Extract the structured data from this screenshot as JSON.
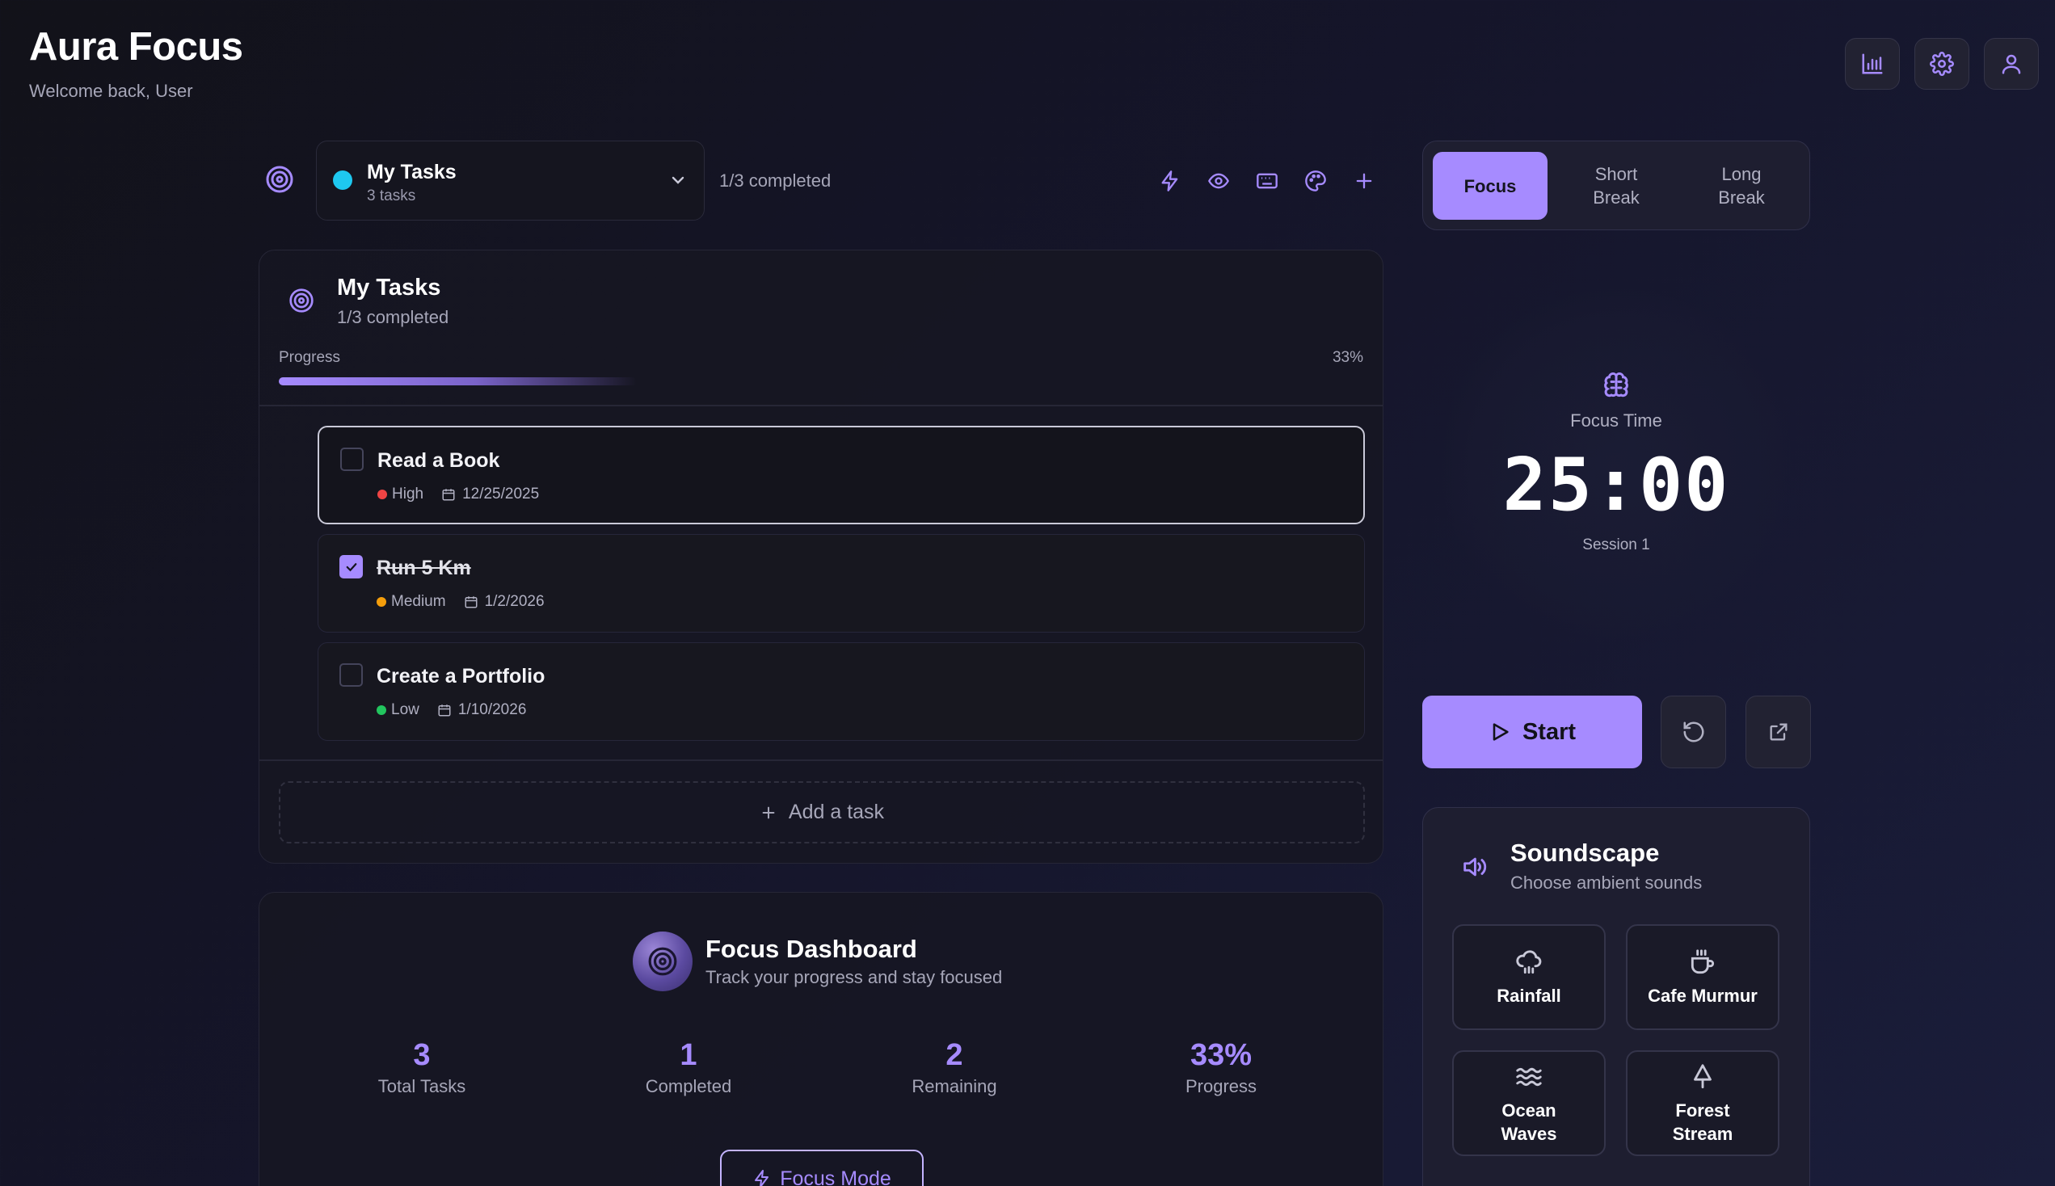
{
  "header": {
    "title": "Aura Focus",
    "subtitle": "Welcome back, User"
  },
  "task_list_selector": {
    "name": "My Tasks",
    "count": "3 tasks",
    "completed_summary": "1/3 completed"
  },
  "tasks_card": {
    "title": "My Tasks",
    "subtitle": "1/3 completed",
    "progress_label": "Progress",
    "progress_text": "33%",
    "progress_value": 0.33,
    "tasks": [
      {
        "name": "Read a Book",
        "priority": "High",
        "priority_color": "#ef4444",
        "date": "12/25/2025",
        "done": false
      },
      {
        "name": "Run 5 Km",
        "priority": "Medium",
        "priority_color": "#f59e0b",
        "date": "1/2/2026",
        "done": true
      },
      {
        "name": "Create a Portfolio",
        "priority": "Low",
        "priority_color": "#22c55e",
        "date": "1/10/2026",
        "done": false
      }
    ],
    "add_task_label": "Add a task"
  },
  "dashboard": {
    "title": "Focus Dashboard",
    "subtitle": "Track your progress and stay focused",
    "stats": [
      {
        "value": "3",
        "label": "Total Tasks"
      },
      {
        "value": "1",
        "label": "Completed"
      },
      {
        "value": "2",
        "label": "Remaining"
      },
      {
        "value": "33%",
        "label": "Progress"
      }
    ],
    "focus_mode_label": "Focus Mode"
  },
  "timer": {
    "tabs": [
      {
        "label": "Focus",
        "active": true
      },
      {
        "label": "Short\nBreak",
        "active": false
      },
      {
        "label": "Long\nBreak",
        "active": false
      }
    ],
    "label": "Focus Time",
    "time": "25:00",
    "session": "Session 1",
    "start_label": "Start"
  },
  "soundscape": {
    "title": "Soundscape",
    "subtitle": "Choose ambient sounds",
    "sounds": [
      {
        "label": "Rainfall",
        "icon": "cloud-rain-icon"
      },
      {
        "label": "Cafe Murmur",
        "icon": "coffee-icon"
      },
      {
        "label": "Ocean Waves",
        "icon": "waves-icon"
      },
      {
        "label": "Forest Stream",
        "icon": "tree-icon"
      }
    ]
  },
  "colors": {
    "accent": "#a68bff",
    "background": "#15152a",
    "list_dot": "#1ec8f0"
  }
}
